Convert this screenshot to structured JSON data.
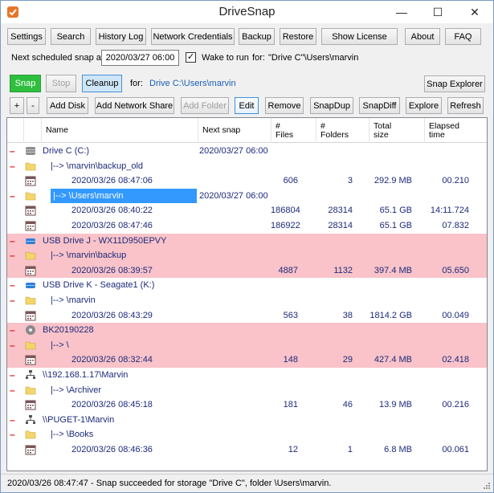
{
  "window": {
    "title": "DriveSnap",
    "minimize_label": "—",
    "maximize_label": "☐",
    "close_label": "✕"
  },
  "toolbar": {
    "settings": "Settings",
    "search": "Search",
    "history_log": "History Log",
    "network_credentials": "Network Credentials",
    "backup": "Backup",
    "restore": "Restore",
    "show_license": "Show License",
    "about": "About",
    "faq": "FAQ"
  },
  "schedule": {
    "label": "Next scheduled snap at:",
    "value": "2020/03/27 06:00",
    "wake_checked": true,
    "wake_label": "Wake to run",
    "for_label": "for:",
    "for_value": "\"Drive C\"\\Users\\marvin"
  },
  "actions": {
    "snap": "Snap",
    "stop": "Stop",
    "cleanup": "Cleanup",
    "for_label": "for:",
    "for_path": "Drive C:\\Users\\marvin",
    "snap_explorer": "Snap Explorer"
  },
  "table_toolbar": {
    "plus": "+",
    "minus": "-",
    "add_disk": "Add Disk",
    "add_network_share": "Add Network Share",
    "add_folder": "Add Folder",
    "edit": "Edit",
    "remove": "Remove",
    "snapdup": "SnapDup",
    "snapdiff": "SnapDiff",
    "explore": "Explore",
    "refresh": "Refresh"
  },
  "table": {
    "columns": {
      "name": "Name",
      "next_snap": "Next snap",
      "files_1": "#",
      "files_2": "Files",
      "folders_1": "#",
      "folders_2": "Folders",
      "size_1": "Total",
      "size_2": "size",
      "elapsed_1": "Elapsed",
      "elapsed_2": "time"
    },
    "rows": [
      {
        "dash": "–",
        "icon": "disk-icon",
        "indent": 0,
        "name": "Drive C (C:)",
        "next": "2020/03/27 06:00",
        "files": "",
        "folders": "",
        "size": "",
        "elapsed": "",
        "pink": false,
        "selected": false
      },
      {
        "dash": "–",
        "icon": "folder-icon",
        "indent": 1,
        "name": "|--> \\marvin\\backup_old",
        "next": "",
        "files": "",
        "folders": "",
        "size": "",
        "elapsed": "",
        "pink": false,
        "selected": false
      },
      {
        "dash": "",
        "icon": "calendar-icon",
        "indent": 2,
        "name": "2020/03/26 08:47:06",
        "next": "",
        "files": "606",
        "folders": "3",
        "size": "292.9 MB",
        "elapsed": "00.210",
        "pink": false,
        "selected": false
      },
      {
        "dash": "–",
        "icon": "folder-icon",
        "indent": 1,
        "name": "|--> \\Users\\marvin",
        "next": "2020/03/27 06:00",
        "files": "",
        "folders": "",
        "size": "",
        "elapsed": "",
        "pink": false,
        "selected": true
      },
      {
        "dash": "",
        "icon": "calendar-icon",
        "indent": 2,
        "name": "2020/03/26 08:40:22",
        "next": "",
        "files": "186804",
        "folders": "28314",
        "size": "65.1 GB",
        "elapsed": "14:11.724",
        "pink": false,
        "selected": false
      },
      {
        "dash": "",
        "icon": "calendar-icon",
        "indent": 2,
        "name": "2020/03/26 08:47:46",
        "next": "",
        "files": "186922",
        "folders": "28314",
        "size": "65.1 GB",
        "elapsed": "07.832",
        "pink": false,
        "selected": false
      },
      {
        "dash": "–",
        "icon": "usb-drive-icon",
        "indent": 0,
        "name": "USB Drive J - WX11D950EPVY",
        "next": "",
        "files": "",
        "folders": "",
        "size": "",
        "elapsed": "",
        "pink": true,
        "selected": false
      },
      {
        "dash": "–",
        "icon": "folder-icon",
        "indent": 1,
        "name": "|--> \\marvin\\backup",
        "next": "",
        "files": "",
        "folders": "",
        "size": "",
        "elapsed": "",
        "pink": true,
        "selected": false
      },
      {
        "dash": "",
        "icon": "calendar-icon",
        "indent": 2,
        "name": "2020/03/26 08:39:57",
        "next": "",
        "files": "4887",
        "folders": "1132",
        "size": "397.4 MB",
        "elapsed": "05.650",
        "pink": true,
        "selected": false
      },
      {
        "dash": "–",
        "icon": "usb-drive-icon",
        "indent": 0,
        "name": "USB Drive K - Seagate1 (K:)",
        "next": "",
        "files": "",
        "folders": "",
        "size": "",
        "elapsed": "",
        "pink": false,
        "selected": false
      },
      {
        "dash": "–",
        "icon": "folder-icon",
        "indent": 1,
        "name": "|--> \\marvin",
        "next": "",
        "files": "",
        "folders": "",
        "size": "",
        "elapsed": "",
        "pink": false,
        "selected": false
      },
      {
        "dash": "",
        "icon": "calendar-icon",
        "indent": 2,
        "name": "2020/03/26 08:43:29",
        "next": "",
        "files": "563",
        "folders": "38",
        "size": "1814.2 GB",
        "elapsed": "00.049",
        "pink": false,
        "selected": false
      },
      {
        "dash": "–",
        "icon": "optical-disc-icon",
        "indent": 0,
        "name": "BK20190228",
        "next": "",
        "files": "",
        "folders": "",
        "size": "",
        "elapsed": "",
        "pink": true,
        "selected": false
      },
      {
        "dash": "–",
        "icon": "folder-icon",
        "indent": 1,
        "name": "|--> \\",
        "next": "",
        "files": "",
        "folders": "",
        "size": "",
        "elapsed": "",
        "pink": true,
        "selected": false
      },
      {
        "dash": "",
        "icon": "calendar-icon",
        "indent": 2,
        "name": "2020/03/26 08:32:44",
        "next": "",
        "files": "148",
        "folders": "29",
        "size": "427.4 MB",
        "elapsed": "02.418",
        "pink": true,
        "selected": false
      },
      {
        "dash": "–",
        "icon": "network-icon",
        "indent": 0,
        "name": "\\\\192.168.1.17\\Marvin",
        "next": "",
        "files": "",
        "folders": "",
        "size": "",
        "elapsed": "",
        "pink": false,
        "selected": false
      },
      {
        "dash": "–",
        "icon": "folder-icon",
        "indent": 1,
        "name": "|--> \\Archiver",
        "next": "",
        "files": "",
        "folders": "",
        "size": "",
        "elapsed": "",
        "pink": false,
        "selected": false
      },
      {
        "dash": "",
        "icon": "calendar-icon",
        "indent": 2,
        "name": "2020/03/26 08:45:18",
        "next": "",
        "files": "181",
        "folders": "46",
        "size": "13.9 MB",
        "elapsed": "00.216",
        "pink": false,
        "selected": false
      },
      {
        "dash": "–",
        "icon": "network-icon",
        "indent": 0,
        "name": "\\\\PUGET-1\\Marvin",
        "next": "",
        "files": "",
        "folders": "",
        "size": "",
        "elapsed": "",
        "pink": false,
        "selected": false
      },
      {
        "dash": "–",
        "icon": "folder-icon",
        "indent": 1,
        "name": "|--> \\Books",
        "next": "",
        "files": "",
        "folders": "",
        "size": "",
        "elapsed": "",
        "pink": false,
        "selected": false
      },
      {
        "dash": "",
        "icon": "calendar-icon",
        "indent": 2,
        "name": "2020/03/26 08:46:36",
        "next": "",
        "files": "12",
        "folders": "1",
        "size": "6.8 MB",
        "elapsed": "00.061",
        "pink": false,
        "selected": false
      }
    ]
  },
  "status": {
    "text": "2020/03/26 08:47:47 - Snap succeeded for storage \"Drive C\", folder \\Users\\marvin."
  },
  "colors": {
    "pink_row": "#f9c3c9",
    "selection": "#3399ff",
    "snap_green": "#2fbf3f",
    "tree_text": "#1c2a7a",
    "dash_red": "#dd2222"
  }
}
